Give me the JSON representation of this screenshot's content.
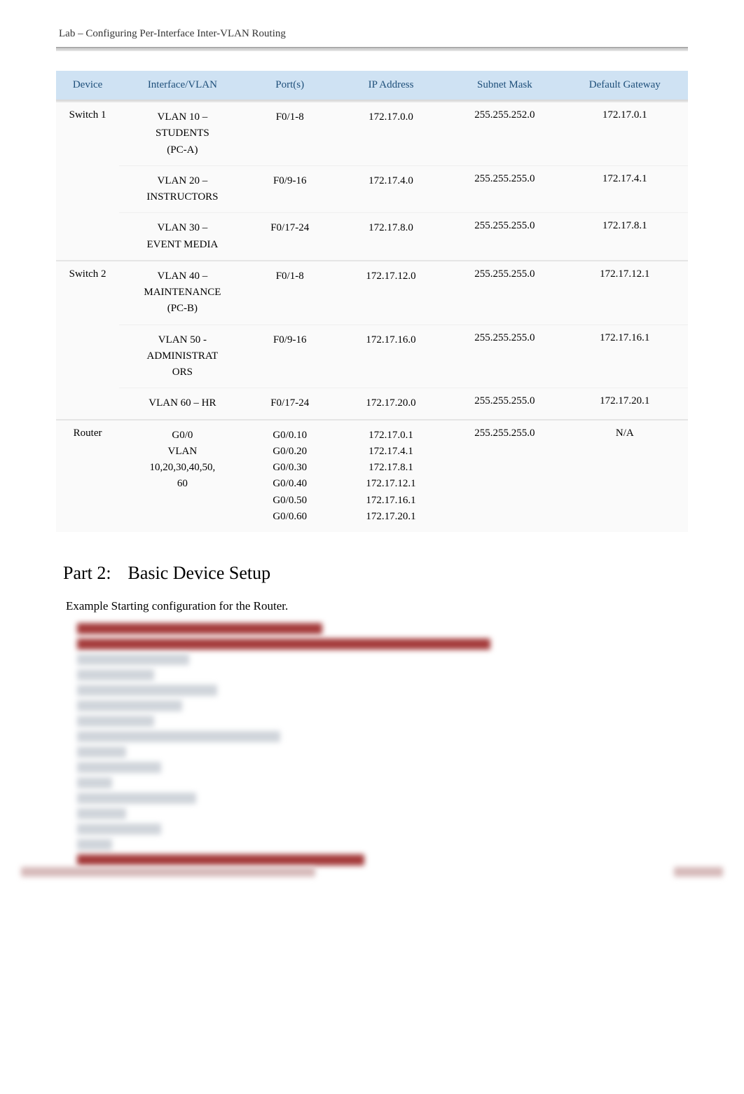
{
  "header": {
    "title": "Lab – Configuring Per-Interface Inter-VLAN Routing"
  },
  "table": {
    "headers": {
      "device": "Device",
      "iface": "Interface/VLAN",
      "ports": "Port(s)",
      "ip": "IP Address",
      "mask": "Subnet Mask",
      "gateway": "Default Gateway"
    },
    "rows": [
      {
        "device": "Switch 1",
        "iface": "VLAN 10 –\nSTUDENTS\n(PC-A)",
        "ports": "F0/1-8",
        "ip": "172.17.0.0",
        "mask": "255.255.252.0",
        "gateway": "172.17.0.1",
        "group_start": true
      },
      {
        "device": "",
        "iface": "VLAN 20 –\nINSTRUCTORS",
        "ports": "F0/9-16",
        "ip": "172.17.4.0",
        "mask": "255.255.255.0",
        "gateway": "172.17.4.1",
        "group_start": false
      },
      {
        "device": "",
        "iface": "VLAN 30 –\nEVENT MEDIA",
        "ports": "F0/17-24",
        "ip": "172.17.8.0",
        "mask": "255.255.255.0",
        "gateway": "172.17.8.1",
        "group_start": false
      },
      {
        "device": "Switch 2",
        "iface": "VLAN 40 –\nMAINTENANCE\n(PC-B)",
        "ports": "F0/1-8",
        "ip": "172.17.12.0",
        "mask": "255.255.255.0",
        "gateway": "172.17.12.1",
        "group_start": true
      },
      {
        "device": "",
        "iface": "VLAN 50 -\nADMINISTRAT\nORS",
        "ports": "F0/9-16",
        "ip": "172.17.16.0",
        "mask": "255.255.255.0",
        "gateway": "172.17.16.1",
        "group_start": false
      },
      {
        "device": "",
        "iface": "VLAN 60 – HR",
        "ports": "F0/17-24",
        "ip": "172.17.20.0",
        "mask": "255.255.255.0",
        "gateway": "172.17.20.1",
        "group_start": false
      },
      {
        "device": "Router",
        "iface": "G0/0\nVLAN\n10,20,30,40,50,\n60",
        "ports": "G0/0.10\nG0/0.20\nG0/0.30\nG0/0.40\nG0/0.50\nG0/0.60",
        "ip": "172.17.0.1\n172.17.4.1\n172.17.8.1\n172.17.12.1\n172.17.16.1\n172.17.20.1",
        "mask": "255.255.255.0",
        "gateway": "N/A",
        "group_start": true
      }
    ]
  },
  "section": {
    "partnum": "Part 2:",
    "title": "Basic Device Setup"
  },
  "example_line": "Example Starting configuration for the Router.",
  "obscured_widths_red": [
    350,
    590
  ],
  "obscured_widths_grey": [
    160,
    110,
    200,
    150,
    110,
    290,
    70,
    120,
    50,
    170,
    70,
    120,
    50
  ],
  "obscured_last_red": 410
}
